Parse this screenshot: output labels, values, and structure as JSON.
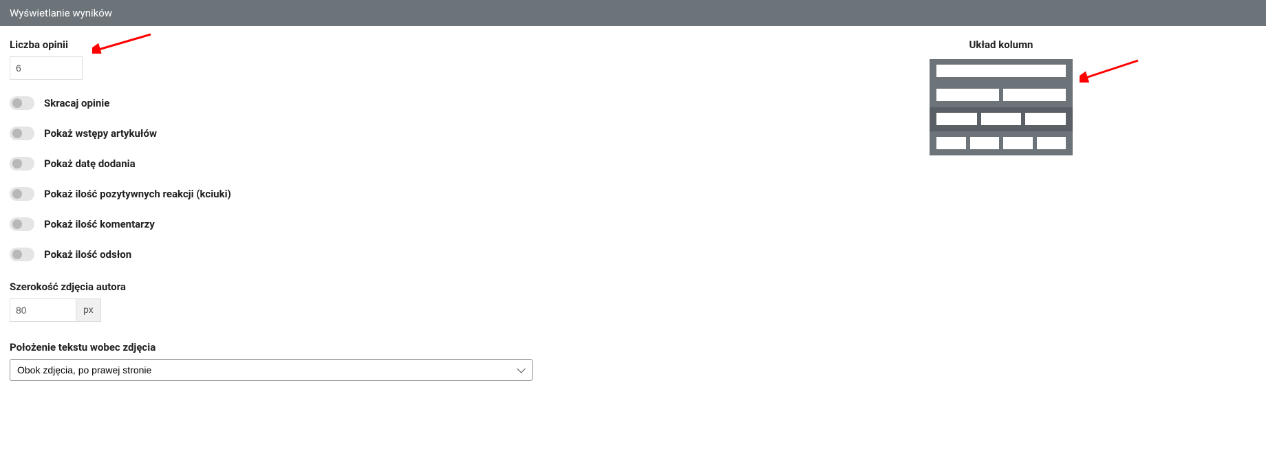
{
  "header": {
    "title": "Wyświetlanie wyników"
  },
  "left": {
    "opinion_count": {
      "label": "Liczba opinii",
      "value": "6"
    },
    "toggles": {
      "shorten": {
        "label": "Skracaj opinie"
      },
      "show_intros": {
        "label": "Pokaż wstępy artykułów"
      },
      "show_date": {
        "label": "Pokaż datę dodania"
      },
      "show_reactions": {
        "label": "Pokaż ilość pozytywnych reakcji (kciuki)"
      },
      "show_comments": {
        "label": "Pokaż ilość komentarzy"
      },
      "show_views": {
        "label": "Pokaż ilość odsłon"
      }
    },
    "author_img_width": {
      "label": "Szerokość zdjęcia autora",
      "value": "80",
      "suffix": "px"
    },
    "text_position": {
      "label": "Położenie tekstu wobec zdjęcia",
      "value": "Obok zdjęcia, po prawej stronie"
    }
  },
  "right": {
    "title": "Układ kolumn"
  }
}
